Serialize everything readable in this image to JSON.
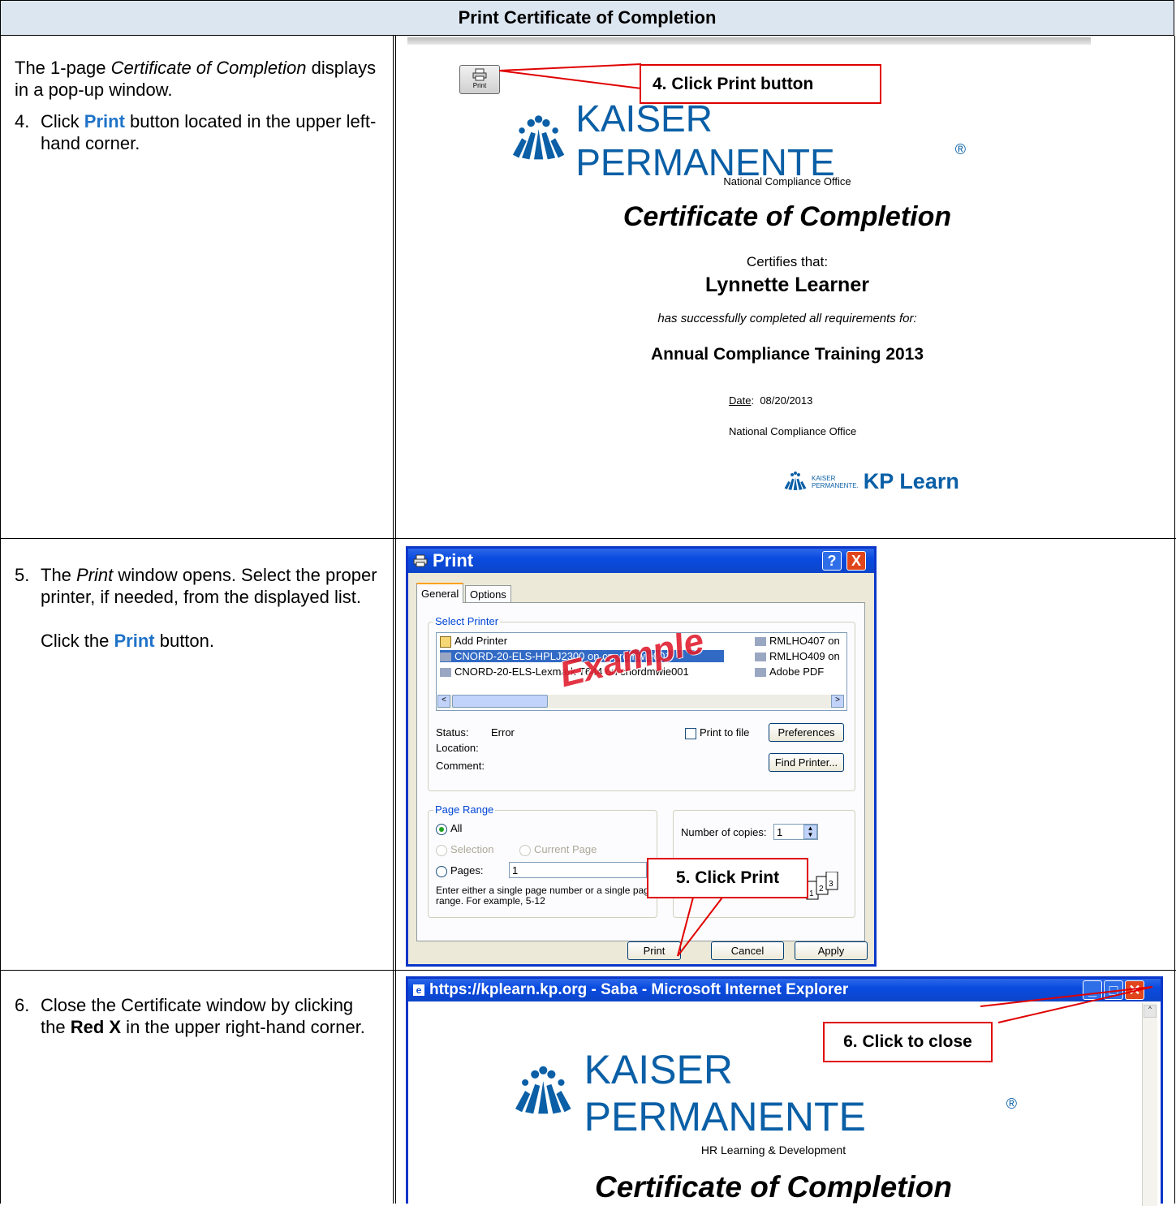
{
  "header": {
    "title": "Print Certificate of Completion"
  },
  "step4": {
    "intro_pre": "The 1-page ",
    "intro_em": "Certificate of Completion",
    "intro_post": " displays in a pop-up window.",
    "number": "4.",
    "text_pre": "Click ",
    "text_kw": "Print",
    "text_post": " button located in the upper left-hand corner.",
    "callout": "4. Click Print button"
  },
  "certificate": {
    "print_label": "Print",
    "brand": "KAISER PERMANENTE",
    "registered": "®",
    "office": "National Compliance Office",
    "title": "Certificate of Completion",
    "certifies": "Certifies that:",
    "name": "Lynnette Learner",
    "completed": "has successfully completed all requirements for:",
    "course": "Annual Compliance Training 2013",
    "date_label": "Date",
    "date_value": "08/20/2013",
    "office_footer": "National Compliance Office",
    "kp_small1": "KAISER",
    "kp_small2": "PERMANENTE.",
    "kp_learn": "KP Learn"
  },
  "step5": {
    "number": "5.",
    "text_pre": "The ",
    "text_em": "Print",
    "text_post": " window opens. Select the proper printer, if needed, from the displayed list.",
    "click_pre": "Click the ",
    "click_kw": "Print",
    "click_post": " button.",
    "callout": "5. Click Print"
  },
  "print_dialog": {
    "title": "Print",
    "help_btn": "?",
    "close_btn": "X",
    "tabs": [
      "General",
      "Options"
    ],
    "select_printer_label": "Select Printer",
    "printers_col1": [
      "Add Printer",
      "CNORD-20-ELS-HPLJ2300 on cnordmwie001",
      "CNORD-20-ELS-Lexmark T644 on cnordmwie001"
    ],
    "printers_col2": [
      "RMLHO407 on",
      "RMLHO409 on",
      "Adobe PDF"
    ],
    "watermark": "Example",
    "status_label": "Status:",
    "status_value": "Error",
    "location_label": "Location:",
    "comment_label": "Comment:",
    "print_to_file": "Print to file",
    "preferences": "Preferences",
    "find_printer": "Find Printer...",
    "page_range_label": "Page Range",
    "all": "All",
    "selection": "Selection",
    "current_page": "Current Page",
    "pages": "Pages:",
    "pages_value": "1",
    "hint": "Enter either a single page number or a single page range.  For example, 5-12",
    "copies_label": "Number of copies:",
    "copies_value": "1",
    "btn_print": "Print",
    "btn_cancel": "Cancel",
    "btn_apply": "Apply"
  },
  "step6": {
    "number": "6.",
    "text_pre": "Close the Certificate window by clicking the ",
    "text_kw": "Red X",
    "text_post": " in the upper right-hand corner.",
    "callout": "6. Click to close"
  },
  "ie_window": {
    "title": "https://kplearn.kp.org - Saba - Microsoft Internet Explorer",
    "brand": "KAISER PERMANENTE",
    "registered": "®",
    "subtitle": "HR Learning & Development",
    "cert_title": "Certificate of Completion"
  },
  "colors": {
    "accent_blue": "#1f73c8",
    "callout_red": "#e00000",
    "header_bg": "#dce6f1",
    "xp_blue": "#0a4be0",
    "kp_blue": "#0a5fa6"
  }
}
